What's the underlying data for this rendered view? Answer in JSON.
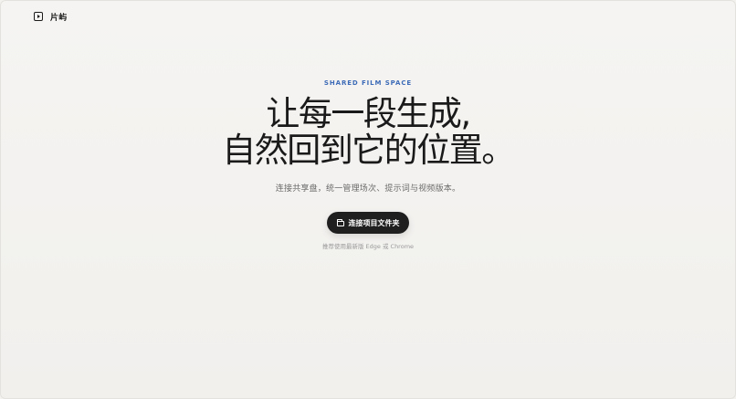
{
  "brand": {
    "name": "片屿",
    "icon": "play-square-icon"
  },
  "hero": {
    "eyebrow": "SHARED FILM SPACE",
    "headline_line1": "让每一段生成,",
    "headline_line2": "自然回到它的位置。",
    "subtitle": "连接共享盘，统一管理场次、提示词与视频版本。"
  },
  "cta": {
    "label": "连接项目文件夹",
    "icon": "folder-icon"
  },
  "hint": "推荐使用最新版 Edge 或 Chrome",
  "colors": {
    "accent": "#3d6bb7",
    "button_bg": "#1f1f1f",
    "page_bg": "#f3f2ef"
  }
}
